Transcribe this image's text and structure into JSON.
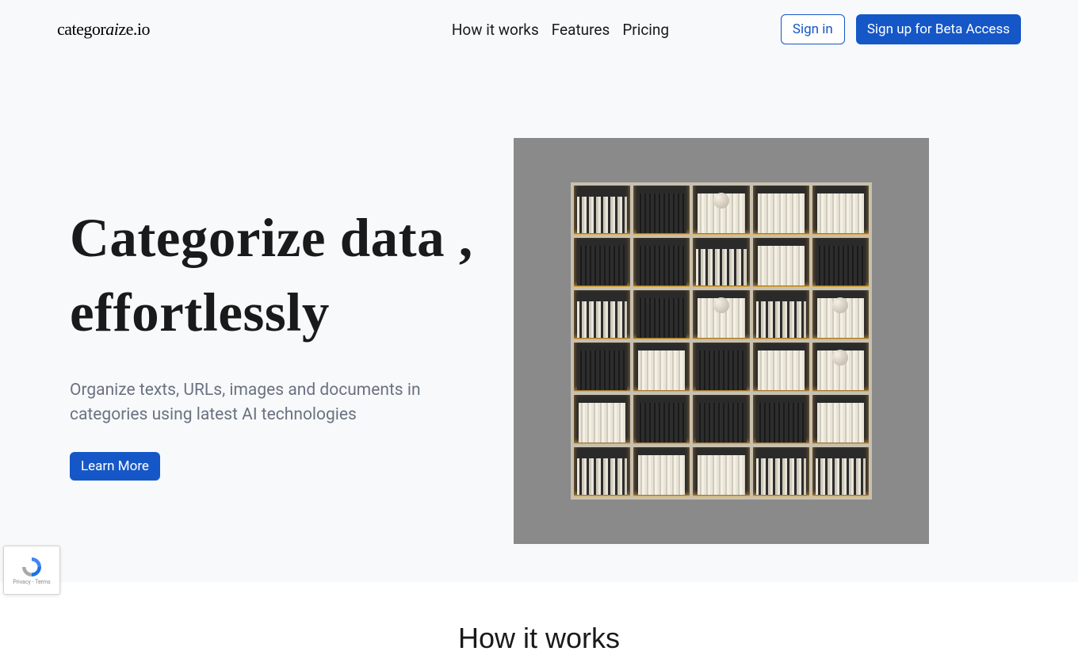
{
  "logo": {
    "pre": "categor",
    "ai": "ai",
    "post": "ze.io"
  },
  "nav": {
    "how": "How it works",
    "features": "Features",
    "pricing": "Pricing"
  },
  "actions": {
    "signin": "Sign in",
    "signup": "Sign up for Beta Access"
  },
  "hero": {
    "title_line1": "Categorize data ,",
    "title_line2": "effortlessly",
    "subtitle": "Organize texts, URLs, images and documents in categories using latest AI technologies",
    "cta": "Learn More"
  },
  "section2": {
    "title": "How it works"
  },
  "recaptcha": {
    "privacy": "Privacy",
    "terms": "Terms"
  }
}
